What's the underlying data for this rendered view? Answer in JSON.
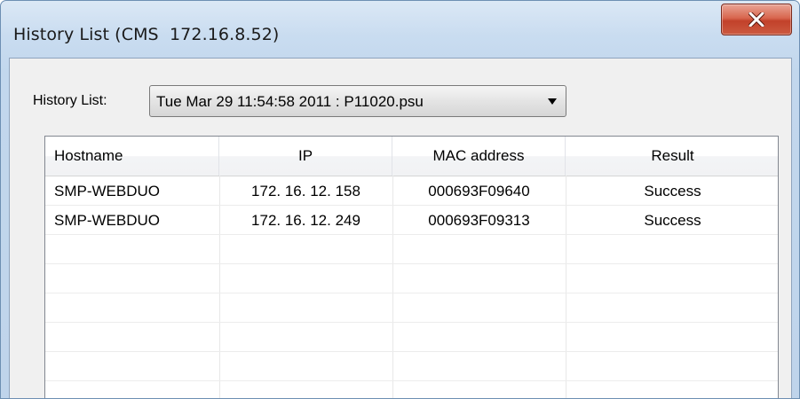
{
  "window": {
    "title": "History List (CMS  172.16.8.52)"
  },
  "history": {
    "label": "History List:",
    "selected": "Tue Mar 29 11:54:58 2011 : P11020.psu"
  },
  "table": {
    "columns": [
      "Hostname",
      "IP",
      "MAC address",
      "Result"
    ],
    "rows": [
      {
        "hostname": "SMP-WEBDUO",
        "ip": "172. 16. 12. 158",
        "mac": "000693F09640",
        "result": "Success"
      },
      {
        "hostname": "SMP-WEBDUO",
        "ip": "172. 16. 12. 249",
        "mac": "000693F09313",
        "result": "Success"
      }
    ]
  },
  "icons": {
    "close": "close-icon",
    "dropdown": "chevron-down-icon"
  },
  "colors": {
    "close_button": "#c9452c",
    "titlebar": "#c9dcf0",
    "client_background": "#f0f0f0"
  }
}
